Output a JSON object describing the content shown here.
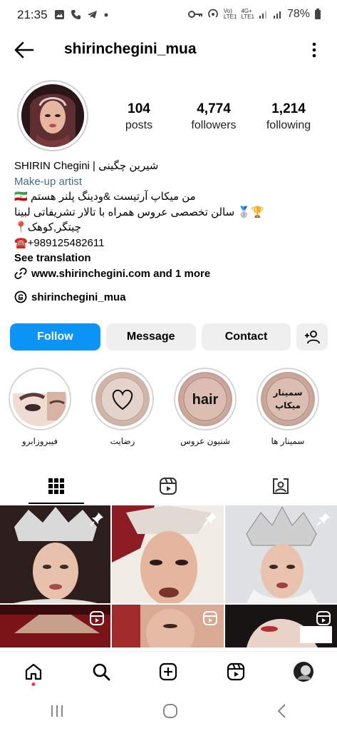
{
  "status_bar": {
    "time": "21:35",
    "battery": "78%",
    "network_small_top": "Vo)",
    "network_small_bottom": "LTE1",
    "signal_label_top": "4G+",
    "signal_label_bottom": "LTE1"
  },
  "header": {
    "username": "shirinchegini_mua"
  },
  "stats": [
    {
      "value": "104",
      "label": "posts"
    },
    {
      "value": "4,774",
      "label": "followers"
    },
    {
      "value": "1,214",
      "label": "following"
    }
  ],
  "bio": {
    "name": "SHIRIN Chegini | شیرین چگینی",
    "category": "Make-up artist",
    "line1": "🇮🇷 من میکاپ آرتیست &ودینگ پلنر هستم",
    "line2": "سالن تخصصی عروس  همراه با تالار تشریفاتی لبینا 🥈🏆",
    "line3": "📍چیتگر,کوهک",
    "line4": "☎️+989125482611",
    "see_translation": "See translation",
    "link": "www.shirinchegini.com and 1 more",
    "threads": "shirinchegini_mua"
  },
  "buttons": {
    "follow": "Follow",
    "message": "Message",
    "contact": "Contact"
  },
  "highlights": [
    {
      "label": "فیبروزابرو",
      "icon": "brow-photo"
    },
    {
      "label": "رضایت",
      "icon": "heart-outline-icon"
    },
    {
      "label": "شنیون عروس",
      "text": "hair"
    },
    {
      "label": "سمینار ها",
      "text_top": "سمینار",
      "text_bottom": "میکاپ"
    }
  ],
  "tabs": [
    "grid-icon",
    "reels-icon",
    "tagged-icon"
  ],
  "colors": {
    "accent": "#0c95f6",
    "category": "#4a6a8a",
    "notification_dot": "#ff3040"
  }
}
